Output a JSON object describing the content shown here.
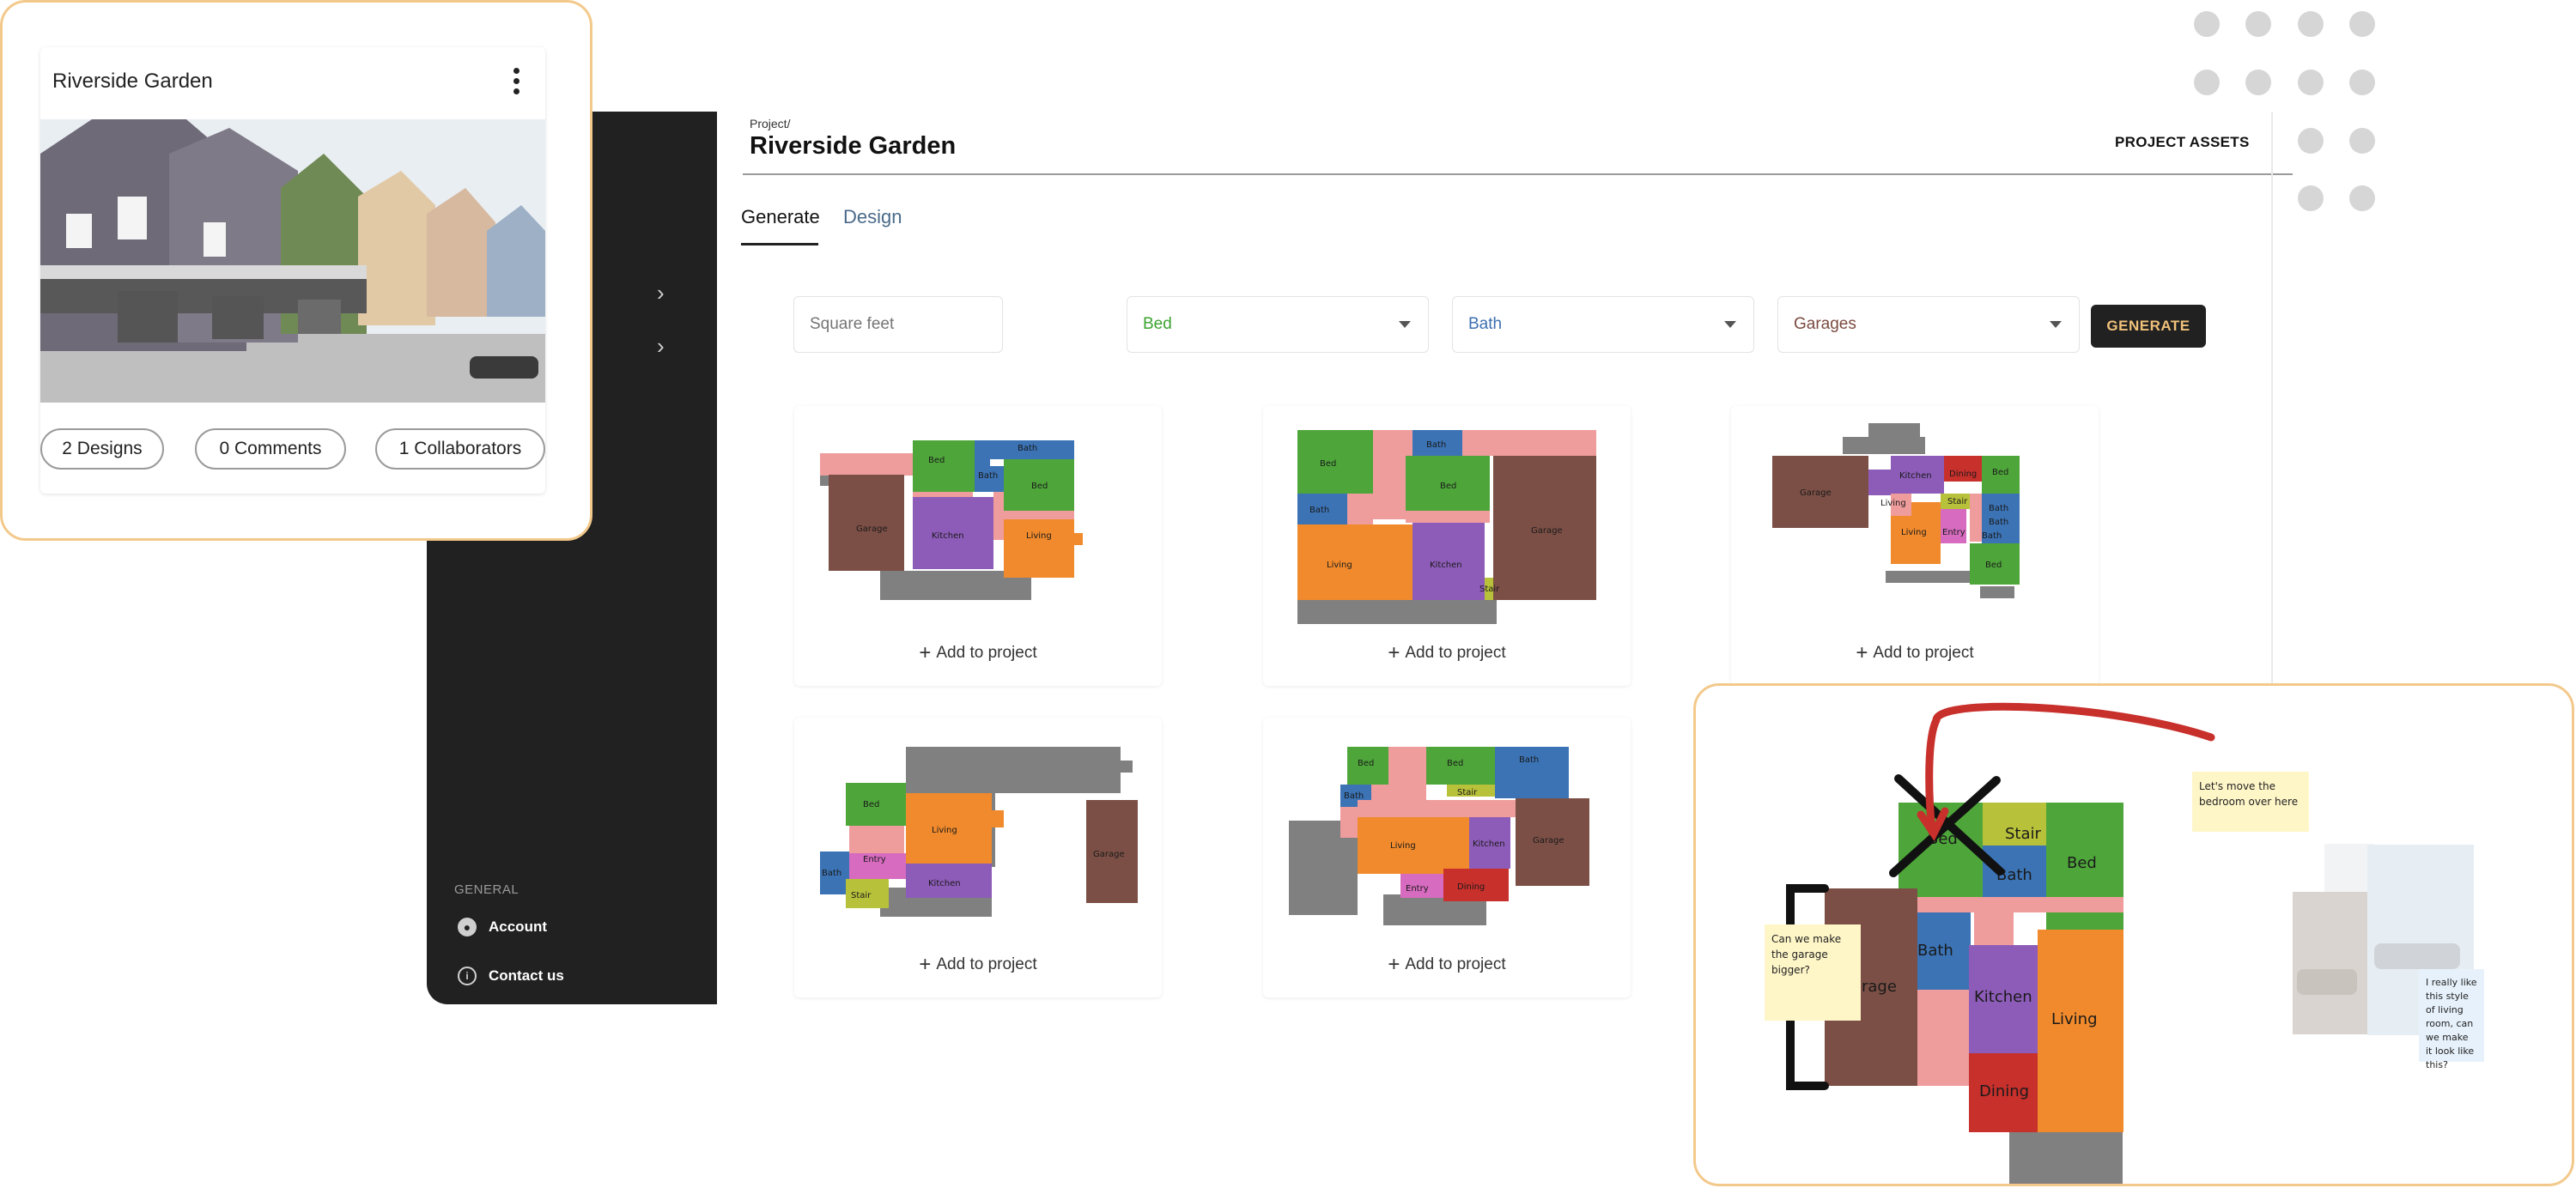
{
  "project": {
    "breadcrumb": "Project/",
    "title": "Riverside Garden",
    "assets_label": "PROJECT ASSETS"
  },
  "tabs": [
    {
      "label": "Generate",
      "active": true
    },
    {
      "label": "Design",
      "active": false
    }
  ],
  "filters": {
    "square_feet_placeholder": "Square feet",
    "bed": {
      "value": "Bed",
      "color": "#3aa32e"
    },
    "bath": {
      "value": "Bath",
      "color": "#3b6fb0"
    },
    "garages": {
      "value": "Garages",
      "color": "#7a4b40"
    },
    "generate_label": "GENERATE"
  },
  "results": {
    "add_label": "Add to project"
  },
  "sidebar": {
    "section_label": "GENERAL",
    "items": [
      {
        "label": "Account",
        "icon": "account-icon"
      },
      {
        "label": "Contact us",
        "icon": "info-icon"
      }
    ]
  },
  "project_card": {
    "title": "Riverside Garden",
    "stats": [
      "2 Designs",
      "0 Comments",
      "1 Collaborators"
    ]
  },
  "annotations": {
    "notes": [
      "Let's move the bedroom over here",
      "Can we make the garage bigger?",
      "I really like this style of living room, can we make it look like this?"
    ]
  },
  "room_labels": {
    "bed": "Bed",
    "bath": "Bath",
    "garage": "Garage",
    "kitchen": "Kitchen",
    "living": "Living",
    "stair": "Stair",
    "entry": "Entry",
    "dining": "Dining"
  },
  "colors": {
    "accent": "#f0c27a",
    "sidebar": "#212121",
    "bed": "#4ea63a",
    "bath": "#3b73b5",
    "garage": "#7b4f45",
    "kitchen": "#8d5cb8",
    "living": "#f08a2c",
    "stair": "#b8c13a",
    "entry": "#d66bbf",
    "dining": "#c8302c",
    "hall": "#ef9c9c",
    "exterior": "#808080"
  }
}
